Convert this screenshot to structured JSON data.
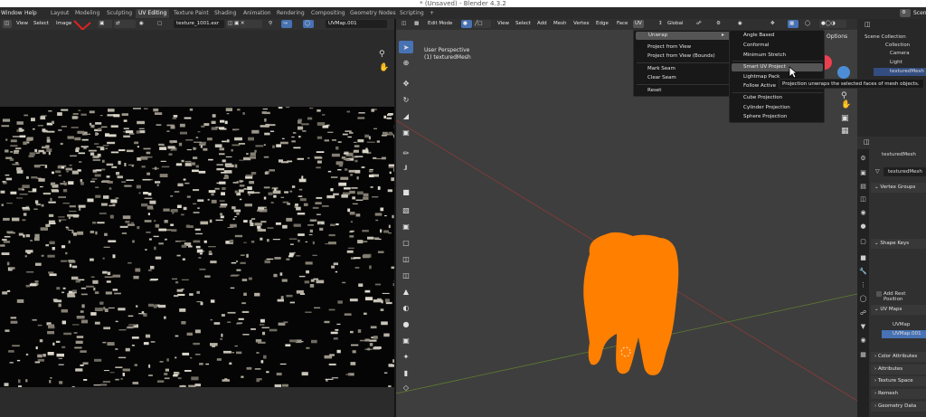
{
  "window": {
    "title": "* (Unsaved) - Blender 4.3.2"
  },
  "topmenu": {
    "items": [
      "Window",
      "Help"
    ]
  },
  "workspaces": [
    "Layout",
    "Modeling",
    "Sculpting",
    "UV Editing",
    "Texture Paint",
    "Shading",
    "Animation",
    "Rendering",
    "Compositing",
    "Geometry Nodes",
    "Scripting",
    "+"
  ],
  "workspace_active": "UV Editing",
  "scene_label": "Scen",
  "image_editor": {
    "menus": [
      "View",
      "Select",
      "Image"
    ],
    "image_name": "texture_1001.exr",
    "uv_map": "UVMap.001"
  },
  "viewport": {
    "mode": "Edit Mode",
    "menus": [
      "View",
      "Select",
      "Add",
      "Mesh",
      "Vertex",
      "Edge",
      "Face",
      "UV"
    ],
    "orientation": "Global",
    "overlay_title": "User Perspective",
    "overlay_object": "(1) texturedMesh",
    "options_label": "Options"
  },
  "uv_menu": {
    "items": [
      "Unwrap",
      "Project from View",
      "Project from View (Bounds)",
      "Mark Seam",
      "Clear Seam",
      "Reset"
    ]
  },
  "unwrap_submenu": {
    "items": [
      "Angle Based",
      "Conformal",
      "Minimum Stretch",
      "Smart UV Project",
      "Lightmap Pack",
      "Follow Active",
      "Cube Projection",
      "Cylinder Projection",
      "Sphere Projection"
    ],
    "highlighted": "Smart UV Project"
  },
  "tooltip": {
    "text": "Projection unwraps the selected faces of mesh objects."
  },
  "outliner": {
    "items": [
      "Scene Collection",
      "Collection",
      "Camera",
      "Light",
      "texturedMesh"
    ]
  },
  "properties": {
    "object_name": "texturedMesh",
    "mesh_name": "texturedMesh",
    "panels": [
      "Vertex Groups",
      "Shape Keys",
      "UV Maps",
      "Color Attributes",
      "Attributes",
      "Texture Space",
      "Remesh",
      "Geometry Data"
    ],
    "add_rest_position": "Add Rest Position",
    "uv_maps": [
      "UVMap",
      "UVMap.001"
    ]
  },
  "colors": {
    "accent": "#4772b3",
    "mesh": "#ff7f00",
    "highlight": "#545454"
  }
}
